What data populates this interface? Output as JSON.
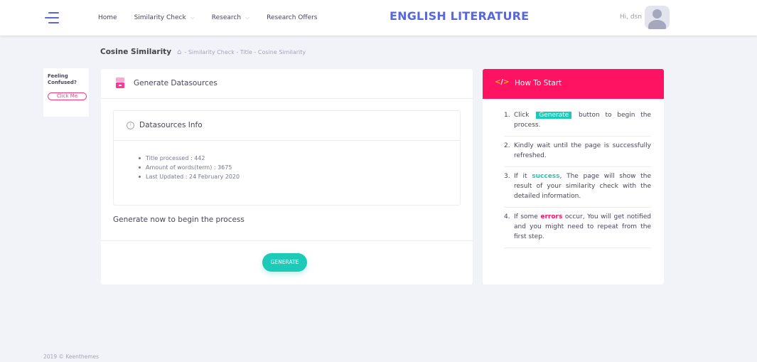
{
  "header": {
    "nav": [
      {
        "label": "Home",
        "has_chevron": false
      },
      {
        "label": "Similarity Check",
        "has_chevron": true
      },
      {
        "label": "Research",
        "has_chevron": true
      },
      {
        "label": "Research Offers",
        "has_chevron": false
      }
    ],
    "app_title": "ENGLISH LITERATURE",
    "greeting": "Hi, dsn"
  },
  "subheader": {
    "title": "Cosine Similarity",
    "breadcrumb": "- Similarity Check - Title - Cosine Similarity"
  },
  "helper": {
    "text_line1": "Feeling",
    "text_line2": "Confused?",
    "button_label": "Click Me"
  },
  "main": {
    "title": "Generate Datasources",
    "info": {
      "title": "Datasources Info",
      "items": [
        "Title processed : 442",
        "Amount of words(term) : 3675",
        "Last Updated : 24 February 2020"
      ]
    },
    "prompt": "Generate now to begin the process",
    "button_label": "GENERATE"
  },
  "how_to": {
    "icon_left": "<",
    "icon_slash": "/",
    "icon_right": ">",
    "title": "How To Start",
    "step1": {
      "num": "1.",
      "pre": "Click",
      "tag": "Generate",
      "post": "button to begin the process."
    },
    "step2": {
      "num": "2.",
      "text": "Kindly wait until the page is successfully refreshed."
    },
    "step3": {
      "num": "3.",
      "pre": "If it",
      "highlight": "success",
      "post": ", The page will show the result of your similarity check with the detailed information."
    },
    "step4": {
      "num": "4.",
      "pre": "If some",
      "highlight": "errors",
      "post": "occur, You will get notified and you might need to repeat from the first step."
    }
  },
  "footer": {
    "text": "2019 © Keenthemes"
  },
  "colors": {
    "primary": "#5867dd",
    "accent_red": "#fd1361",
    "success": "#1dc9b7",
    "warning": "#ffb822"
  },
  "icons": [
    "menu-icon",
    "chevron-down-icon",
    "avatar-icon",
    "home-icon",
    "datasource-icon",
    "info-icon",
    "code-icon"
  ]
}
